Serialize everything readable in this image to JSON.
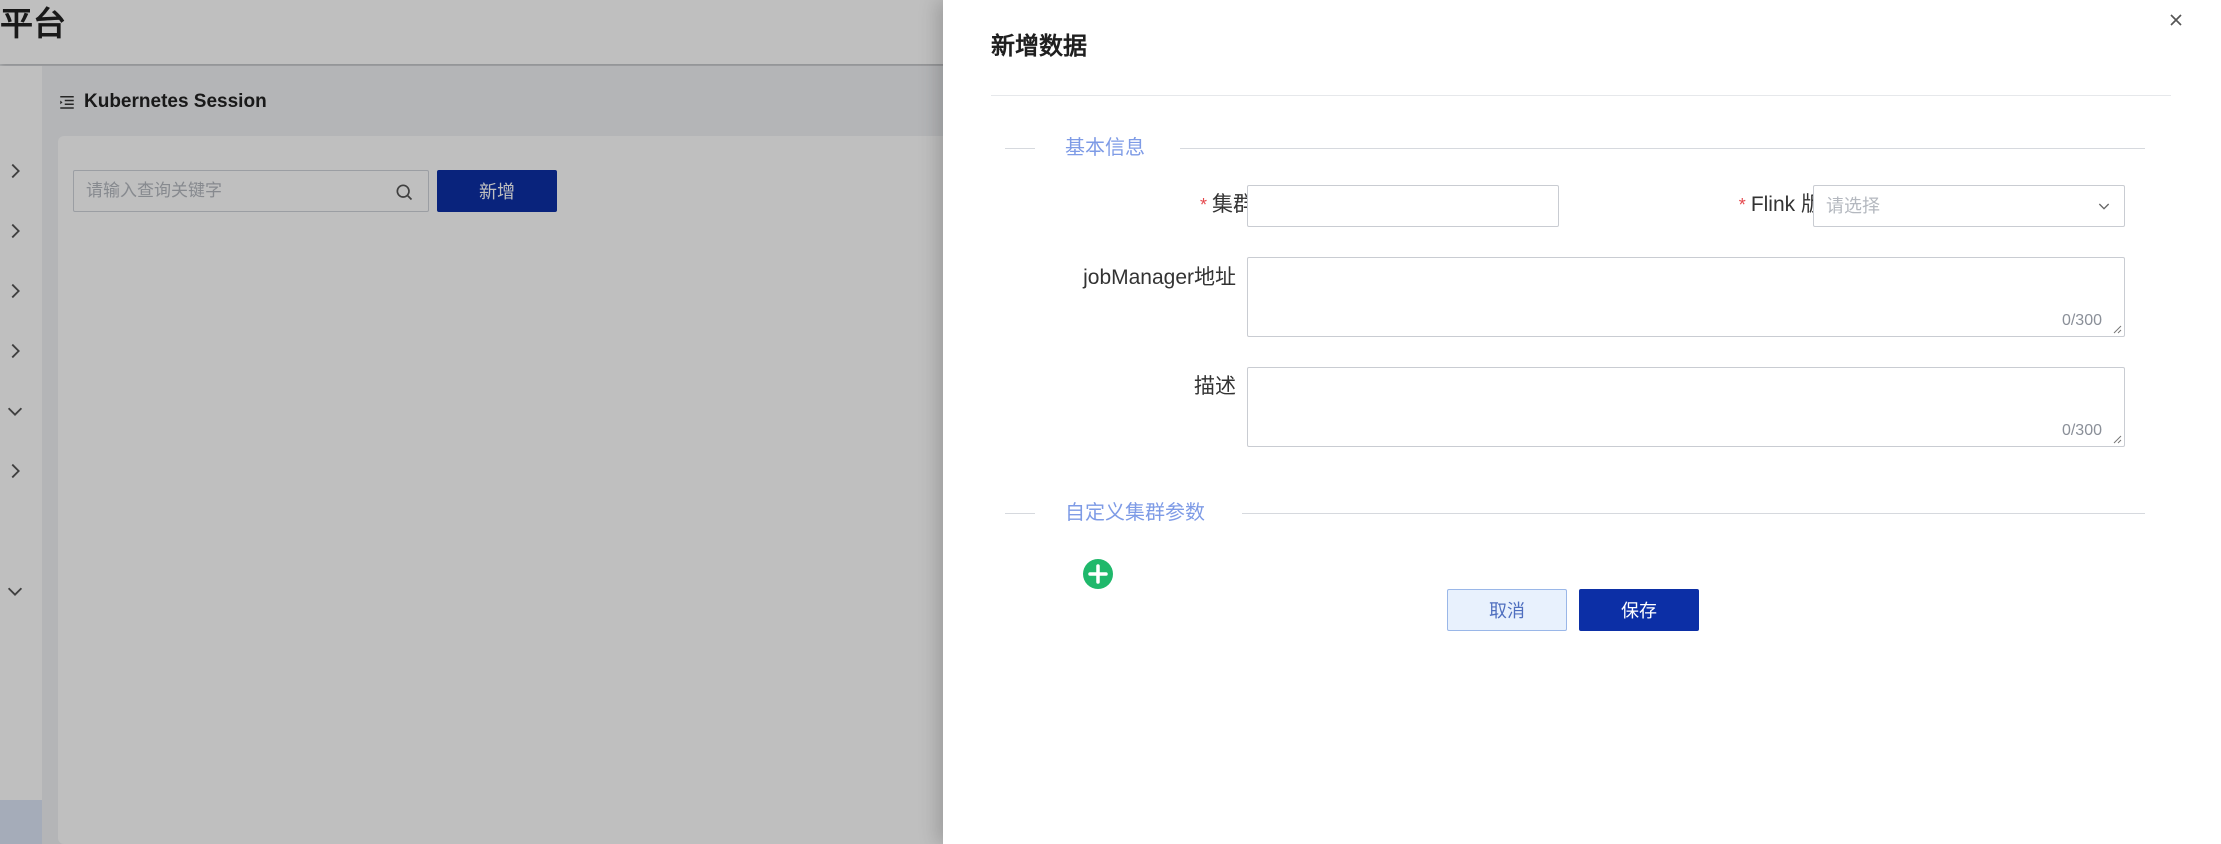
{
  "app": {
    "title": "平台",
    "breadcrumb": "Kubernetes Session",
    "search_placeholder": "请输入查询关键字",
    "add_label": "新增"
  },
  "drawer": {
    "title": "新增数据",
    "sections": {
      "basic": "基本信息",
      "custom": "自定义集群参数"
    },
    "fields": {
      "cluster_name": {
        "label": "集群名称",
        "required": "*",
        "value": ""
      },
      "flink_version": {
        "label": "Flink 版本",
        "required": "*",
        "placeholder": "请选择"
      },
      "job_manager": {
        "label": "jobManager地址",
        "counter": "0/300",
        "value": ""
      },
      "description": {
        "label": "描述",
        "counter": "0/300",
        "value": ""
      }
    },
    "buttons": {
      "cancel": "取消",
      "save": "保存"
    }
  },
  "icons": {
    "close": "close-icon",
    "chevron": "chevron-down-icon",
    "plus": "plus-circle-icon",
    "search": "search-icon"
  },
  "colors": {
    "primary": "#0c2fa6",
    "section_text": "#7e9be6",
    "required": "#e5484d",
    "add_param": "#1fb86b"
  }
}
